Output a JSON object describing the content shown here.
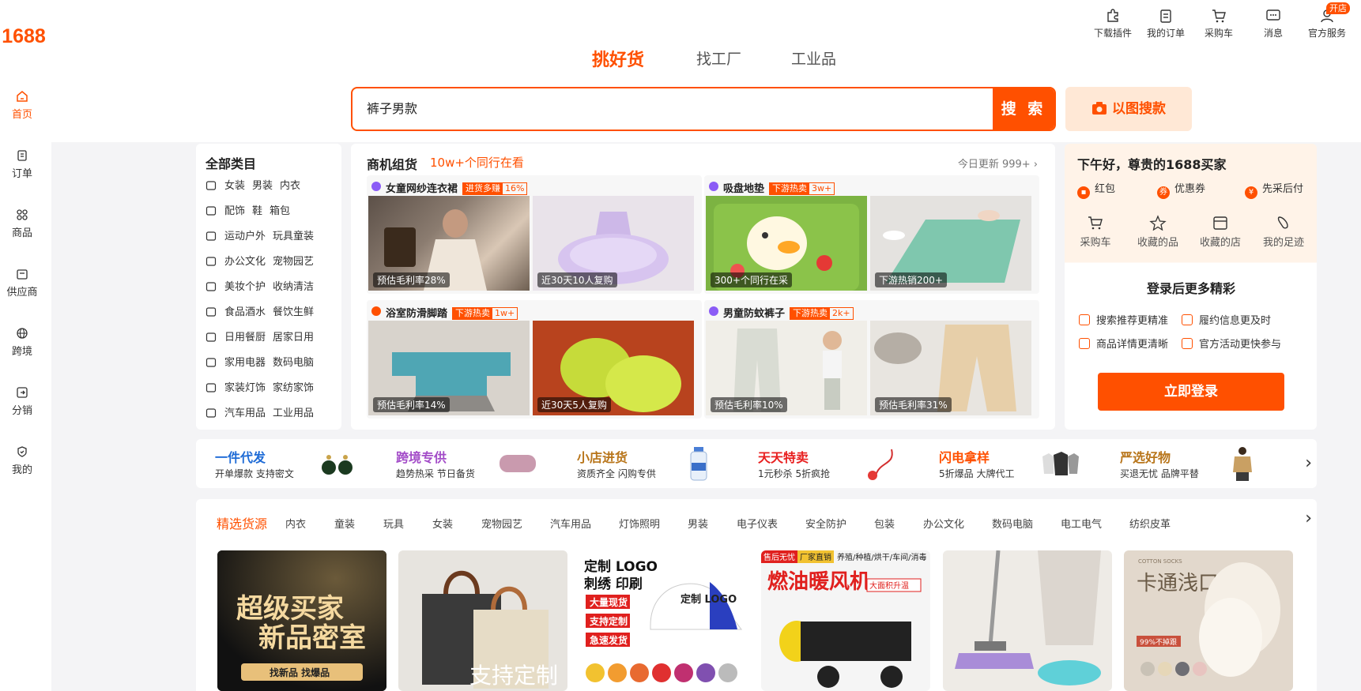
{
  "logo": "1688",
  "leftnav": [
    {
      "label": "首页",
      "icon": "home-icon"
    },
    {
      "label": "订单",
      "icon": "order-icon"
    },
    {
      "label": "商品",
      "icon": "grid-icon"
    },
    {
      "label": "供应商",
      "icon": "supplier-icon"
    },
    {
      "label": "跨境",
      "icon": "globe-icon"
    },
    {
      "label": "分销",
      "icon": "distribution-icon"
    },
    {
      "label": "我的",
      "icon": "profile-icon"
    }
  ],
  "utilities": [
    {
      "label": "下载插件",
      "icon": "puzzle-icon"
    },
    {
      "label": "我的订单",
      "icon": "clipboard-icon"
    },
    {
      "label": "采购车",
      "icon": "cart-icon"
    },
    {
      "label": "消息",
      "icon": "message-icon"
    },
    {
      "label": "官方服务",
      "icon": "service-icon"
    }
  ],
  "kaidian_badge": "开店",
  "search_tabs": [
    "挑好货",
    "找工厂",
    "工业品"
  ],
  "search": {
    "value": "裤子男款",
    "button": "搜 索",
    "image_search": "以图搜款"
  },
  "categories": {
    "title": "全部类目",
    "rows": [
      [
        "女装",
        "男装",
        "内衣"
      ],
      [
        "配饰",
        "鞋",
        "箱包"
      ],
      [
        "运动户外",
        "玩具童装"
      ],
      [
        "办公文化",
        "宠物园艺"
      ],
      [
        "美妆个护",
        "收纳清洁"
      ],
      [
        "食品酒水",
        "餐饮生鲜"
      ],
      [
        "日用餐厨",
        "居家日用"
      ],
      [
        "家用电器",
        "数码电脑"
      ],
      [
        "家装灯饰",
        "家纺家饰"
      ],
      [
        "汽车用品",
        "工业用品"
      ]
    ]
  },
  "business": {
    "title": "商机组货",
    "subtitle": "10w+个同行在看",
    "update": "今日更新 999+",
    "cards": [
      {
        "title": "女童网纱连衣裙",
        "tag_a": "进货多赚",
        "tag_b": "16%",
        "captions": [
          "预估毛利率28%",
          "近30天10人复购"
        ]
      },
      {
        "title": "吸盘地垫",
        "tag_a": "下游热卖",
        "tag_b": "3w+",
        "captions": [
          "300+个同行在采",
          "下游热销200+"
        ]
      },
      {
        "title": "浴室防滑脚踏",
        "tag_a": "下游热卖",
        "tag_b": "1w+",
        "captions": [
          "预估毛利率14%",
          "近30天5人复购"
        ]
      },
      {
        "title": "男童防蚊裤子",
        "tag_a": "下游热卖",
        "tag_b": "2k+",
        "captions": [
          "预估毛利率10%",
          "预估毛利率31%"
        ]
      }
    ]
  },
  "account": {
    "greeting": "下午好，尊贵的1688买家",
    "links": [
      "红包",
      "优惠券",
      "先采后付"
    ],
    "quick": [
      {
        "label": "采购车",
        "icon": "cart-icon"
      },
      {
        "label": "收藏的品",
        "icon": "star-icon"
      },
      {
        "label": "收藏的店",
        "icon": "store-icon"
      },
      {
        "label": "我的足迹",
        "icon": "footprint-icon"
      }
    ],
    "login_more": "登录后更多精彩",
    "benefits": [
      "搜索推荐更精准",
      "履约信息更及时",
      "商品详情更清晰",
      "官方活动更快参与"
    ],
    "login_button": "立即登录"
  },
  "services": [
    {
      "title": "一件代发",
      "desc": "开单爆款 支持密文",
      "color": "#1e6bd6"
    },
    {
      "title": "跨境专供",
      "desc": "趋势热采 节日备货",
      "color": "#a34cc8"
    },
    {
      "title": "小店进货",
      "desc": "资质齐全 闪购专供",
      "color": "#b8751a"
    },
    {
      "title": "天天特卖",
      "desc": "1元秒杀 5折疯抢",
      "color": "#e81e1e"
    },
    {
      "title": "闪电拿样",
      "desc": "5折爆品 大牌代工",
      "color": "#ff5000"
    },
    {
      "title": "严选好物",
      "desc": "买退无忧 品牌平替",
      "color": "#b8751a"
    }
  ],
  "filter_tabs": [
    "精选货源",
    "内衣",
    "童装",
    "玩具",
    "女装",
    "宠物园艺",
    "汽车用品",
    "灯饰照明",
    "男装",
    "电子仪表",
    "安全防护",
    "包装",
    "办公文化",
    "数码电脑",
    "电工电气",
    "纺织皮革"
  ],
  "products": [
    {
      "line1": "超级买家",
      "line2": "新品密室",
      "line3": "找新品  找爆品"
    },
    {
      "overlay": "支持定制"
    },
    {
      "title": "定制 LOGO",
      "sub": "刺绣 印刷",
      "tags": [
        "大量现货",
        "支持定制",
        "急速发货"
      ],
      "cap_text": "定制 LOGO"
    },
    {
      "tags": [
        "售后无忧",
        "厂家直销"
      ],
      "top_text": "养殖/种植/烘干/车间/消毒",
      "title": "燃油暖风机",
      "badge": "大面积升温"
    },
    {},
    {
      "brand": "COTTON SOCKS",
      "title": "卡通浅口",
      "badge": "99%不掉跟"
    }
  ]
}
